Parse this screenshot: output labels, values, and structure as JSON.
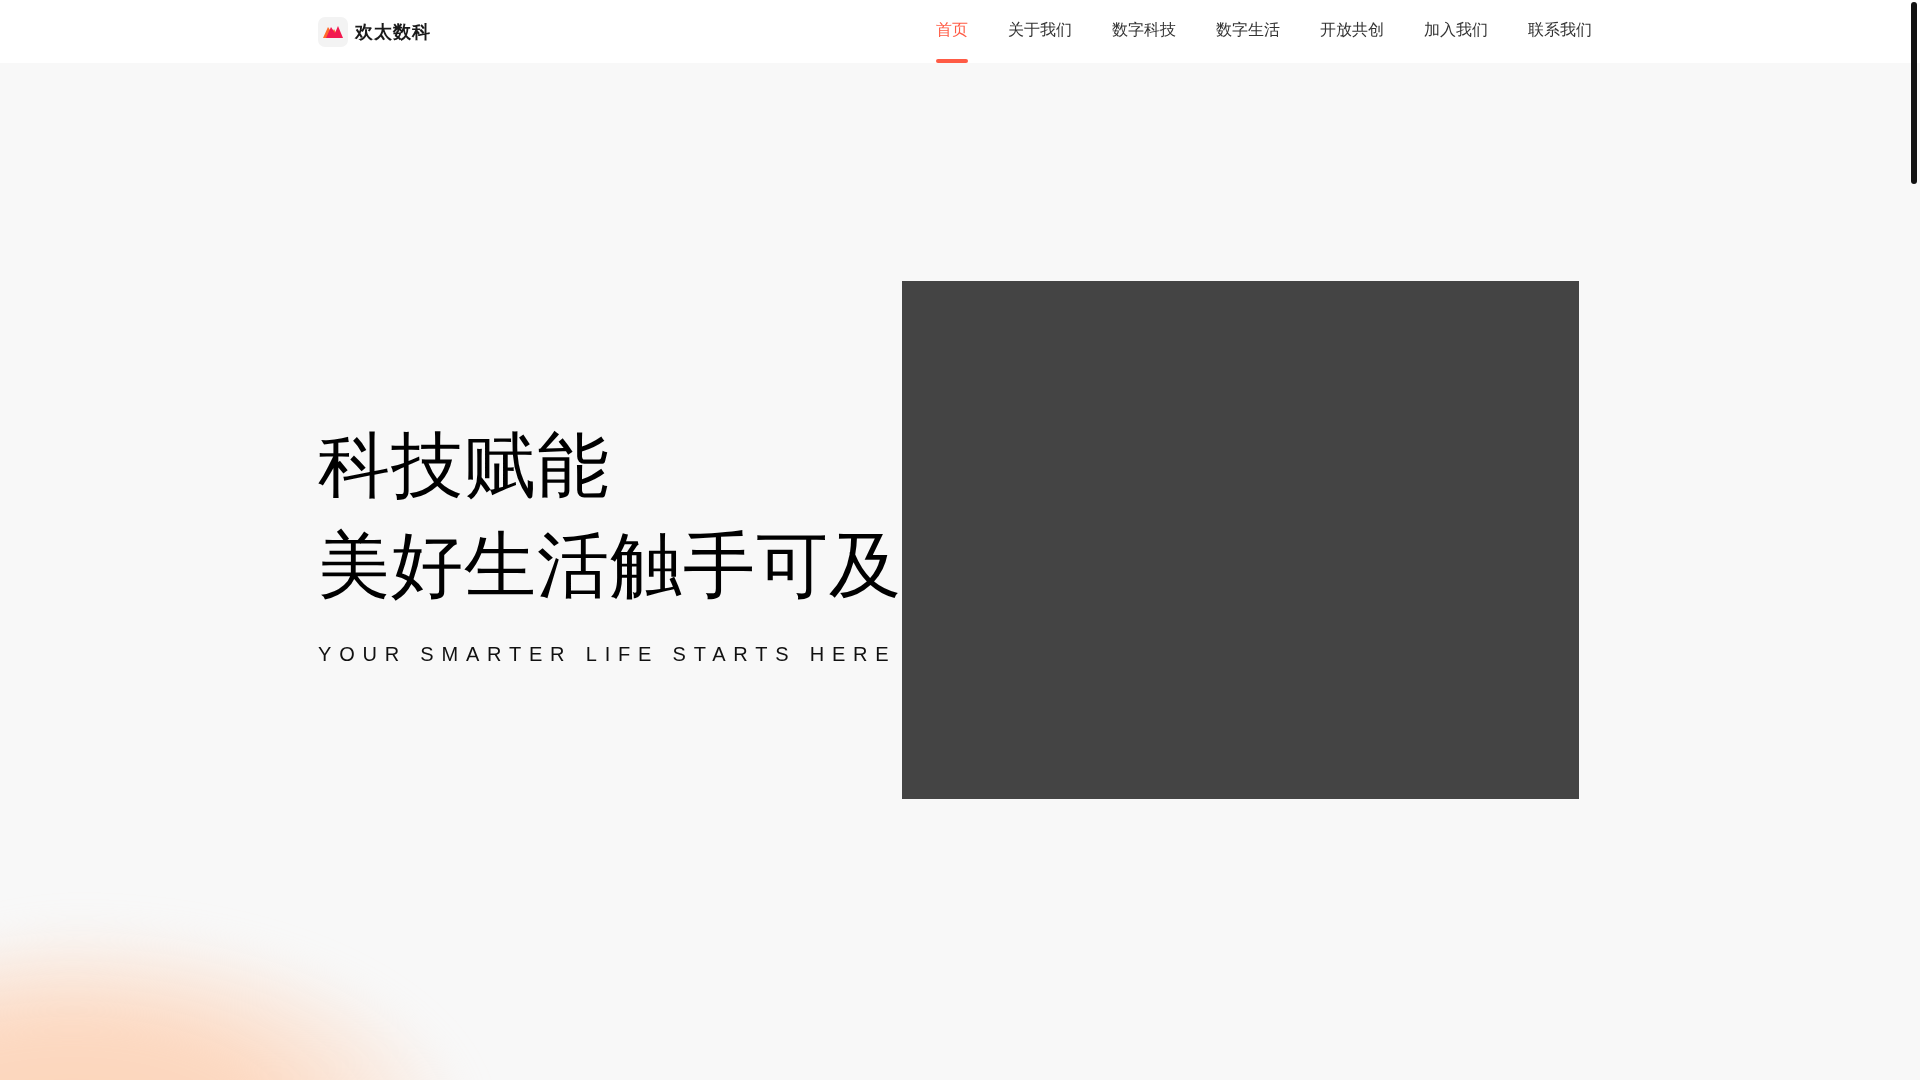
{
  "header": {
    "brand": "欢太数科",
    "nav": [
      {
        "label": "首页",
        "selected": true
      },
      {
        "label": "关于我们",
        "selected": false
      },
      {
        "label": "数字科技",
        "selected": false
      },
      {
        "label": "数字生活",
        "selected": false
      },
      {
        "label": "开放共创",
        "selected": false
      },
      {
        "label": "加入我们",
        "selected": false
      },
      {
        "label": "联系我们",
        "selected": false
      }
    ]
  },
  "hero": {
    "title_lines": [
      "科技赋能",
      "美好生活触手可及"
    ],
    "subtitle": "YOUR SMARTER LIFE STARTS HERE"
  }
}
